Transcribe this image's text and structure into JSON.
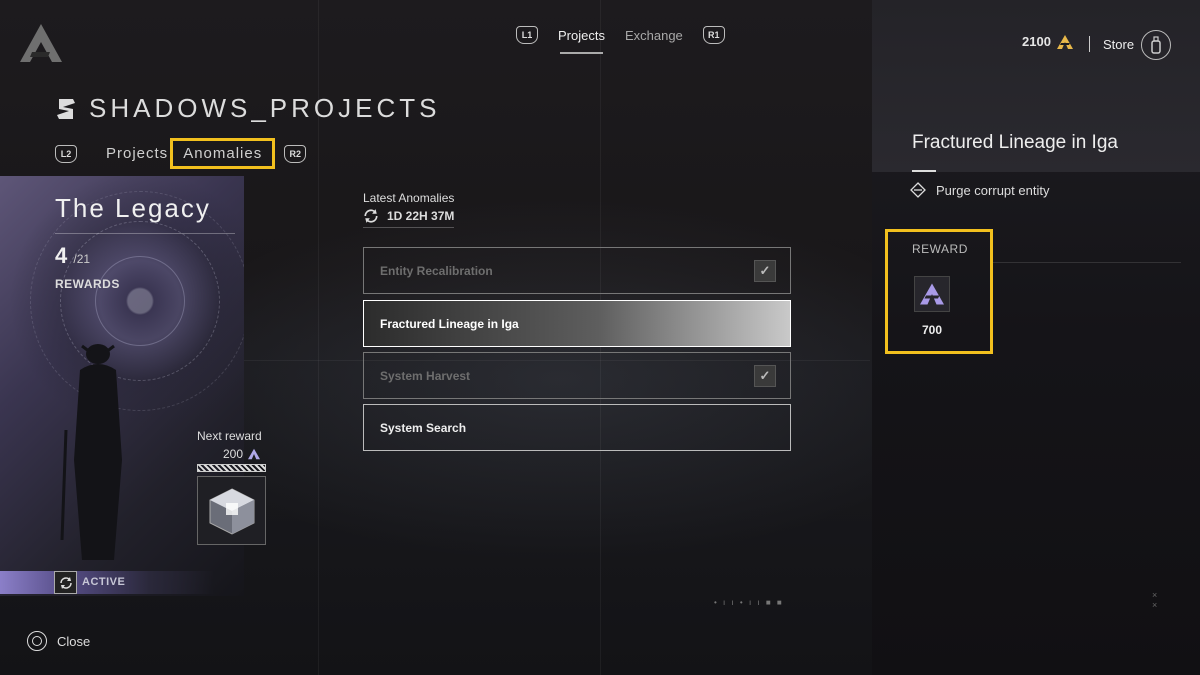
{
  "top_nav": {
    "left_badge": "L1",
    "tabs": [
      {
        "label": "Projects",
        "active": true
      },
      {
        "label": "Exchange",
        "active": false
      }
    ],
    "right_badge": "R1"
  },
  "currency": {
    "amount": "2100",
    "icon": "helix-credit-icon"
  },
  "store": {
    "label": "Store"
  },
  "header": {
    "title": "SHADOWS_PROJECTS",
    "sub_tabs": {
      "left_badge": "L2",
      "projects_label": "Projects",
      "anomalies_label": "Anomalies",
      "right_badge": "R2"
    }
  },
  "legacy": {
    "title": "The Legacy",
    "count": "4",
    "total": "/21",
    "rewards_label": "REWARDS",
    "next_reward_label": "Next reward",
    "next_reward_amount": "200",
    "progress": 1.0,
    "status_label": "ACTIVE"
  },
  "anomalies": {
    "latest_label": "Latest Anomalies",
    "timer": "1D 22H 37M",
    "items": [
      {
        "label": "Entity Recalibration",
        "state": "completed"
      },
      {
        "label": "Fractured Lineage in Iga",
        "state": "selected"
      },
      {
        "label": "System Harvest",
        "state": "completed"
      },
      {
        "label": "System Search",
        "state": "available"
      }
    ],
    "check_mark": "✓"
  },
  "detail": {
    "title": "Fractured Lineage in Iga",
    "objective": "Purge corrupt entity",
    "reward_label": "REWARD",
    "reward_amount": "700"
  },
  "footer": {
    "close_label": "Close"
  },
  "colors": {
    "highlight": "#f2c01e",
    "accent_purple": "#8b7fc8"
  }
}
